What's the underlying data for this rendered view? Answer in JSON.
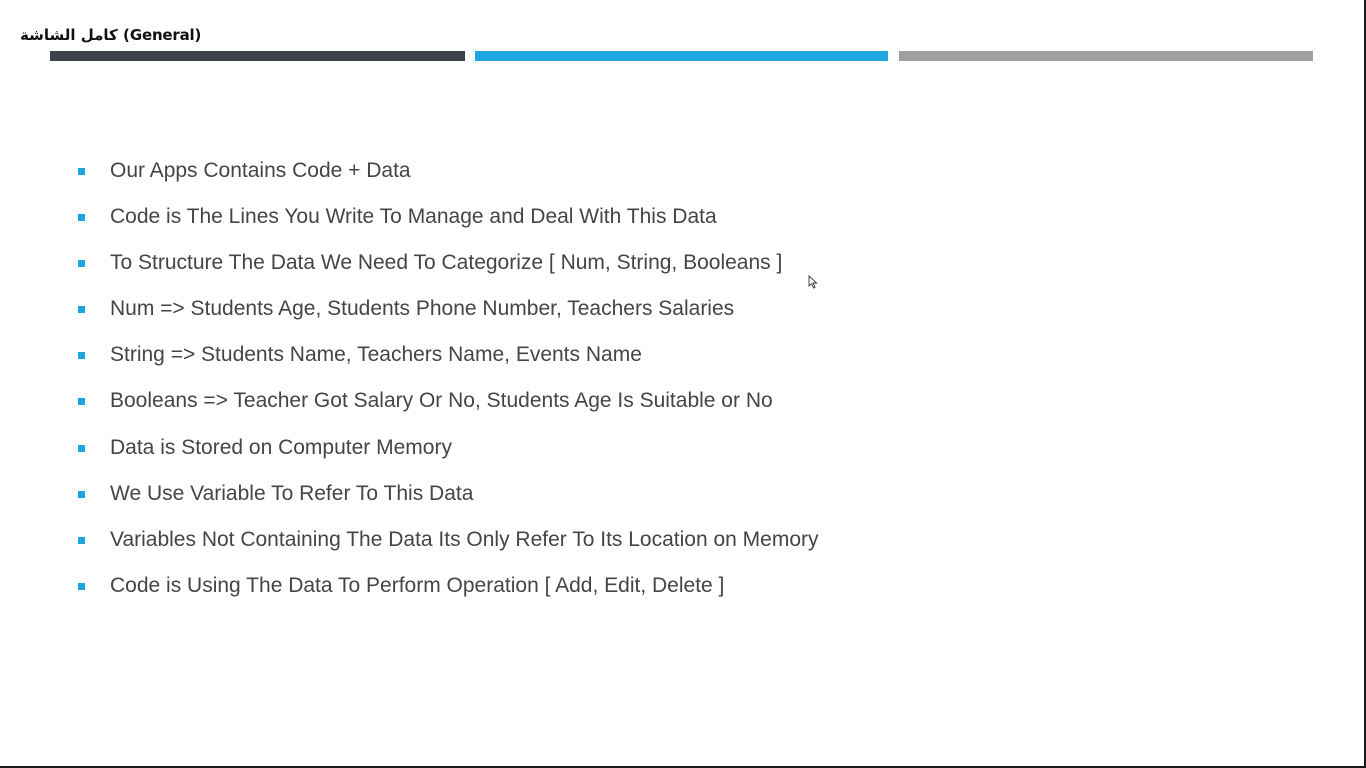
{
  "window": {
    "label": "كامل الشاشة (General)"
  },
  "colors": {
    "bar_dark": "#3d4249",
    "bar_blue": "#1da6df",
    "bar_gray": "#9d9fa3",
    "bullet": "#1da6df",
    "text": "#454545"
  },
  "slide": {
    "bullets": [
      "Our Apps Contains Code + Data",
      "Code is The Lines You Write To Manage and Deal With This Data",
      "To Structure The Data We Need To Categorize [ Num, String, Booleans ]",
      "Num => Students Age, Students Phone Number, Teachers Salaries",
      "String => Students Name, Teachers Name, Events Name",
      "Booleans => Teacher Got Salary Or No, Students Age Is Suitable or No",
      "Data is Stored on Computer Memory",
      "We Use Variable To Refer To This Data",
      "Variables Not Containing The Data Its Only Refer To Its Location on Memory",
      "Code is Using The Data To Perform Operation [ Add, Edit, Delete ]"
    ]
  }
}
